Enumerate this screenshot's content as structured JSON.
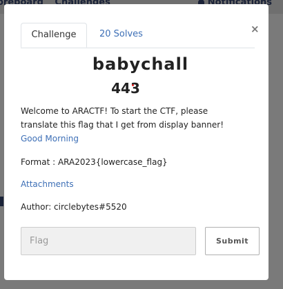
{
  "background_nav": {
    "left_items": [
      "oreboard",
      "Challenges"
    ],
    "notifications": "Notifications"
  },
  "tabs": {
    "challenge": "Challenge",
    "solves": "20 Solves"
  },
  "close_symbol": "×",
  "challenge": {
    "name": "babychall",
    "points": "443",
    "description_line1": "Welcome to ARACTF! To start the CTF, please",
    "description_line2": "translate this flag that I get from display banner!",
    "description_link": "Good Morning",
    "format": "Format : ARA2023{lowercase_flag}",
    "attachments": "Attachments",
    "author": "Author: circlebytes#5520"
  },
  "flag_input": {
    "placeholder": "Flag",
    "value": ""
  },
  "submit_label": "Submit",
  "colors": {
    "link": "#3d6fb6",
    "text": "#222222",
    "overlay": "#7a7a7a",
    "input_bg": "#f0f0f0"
  }
}
